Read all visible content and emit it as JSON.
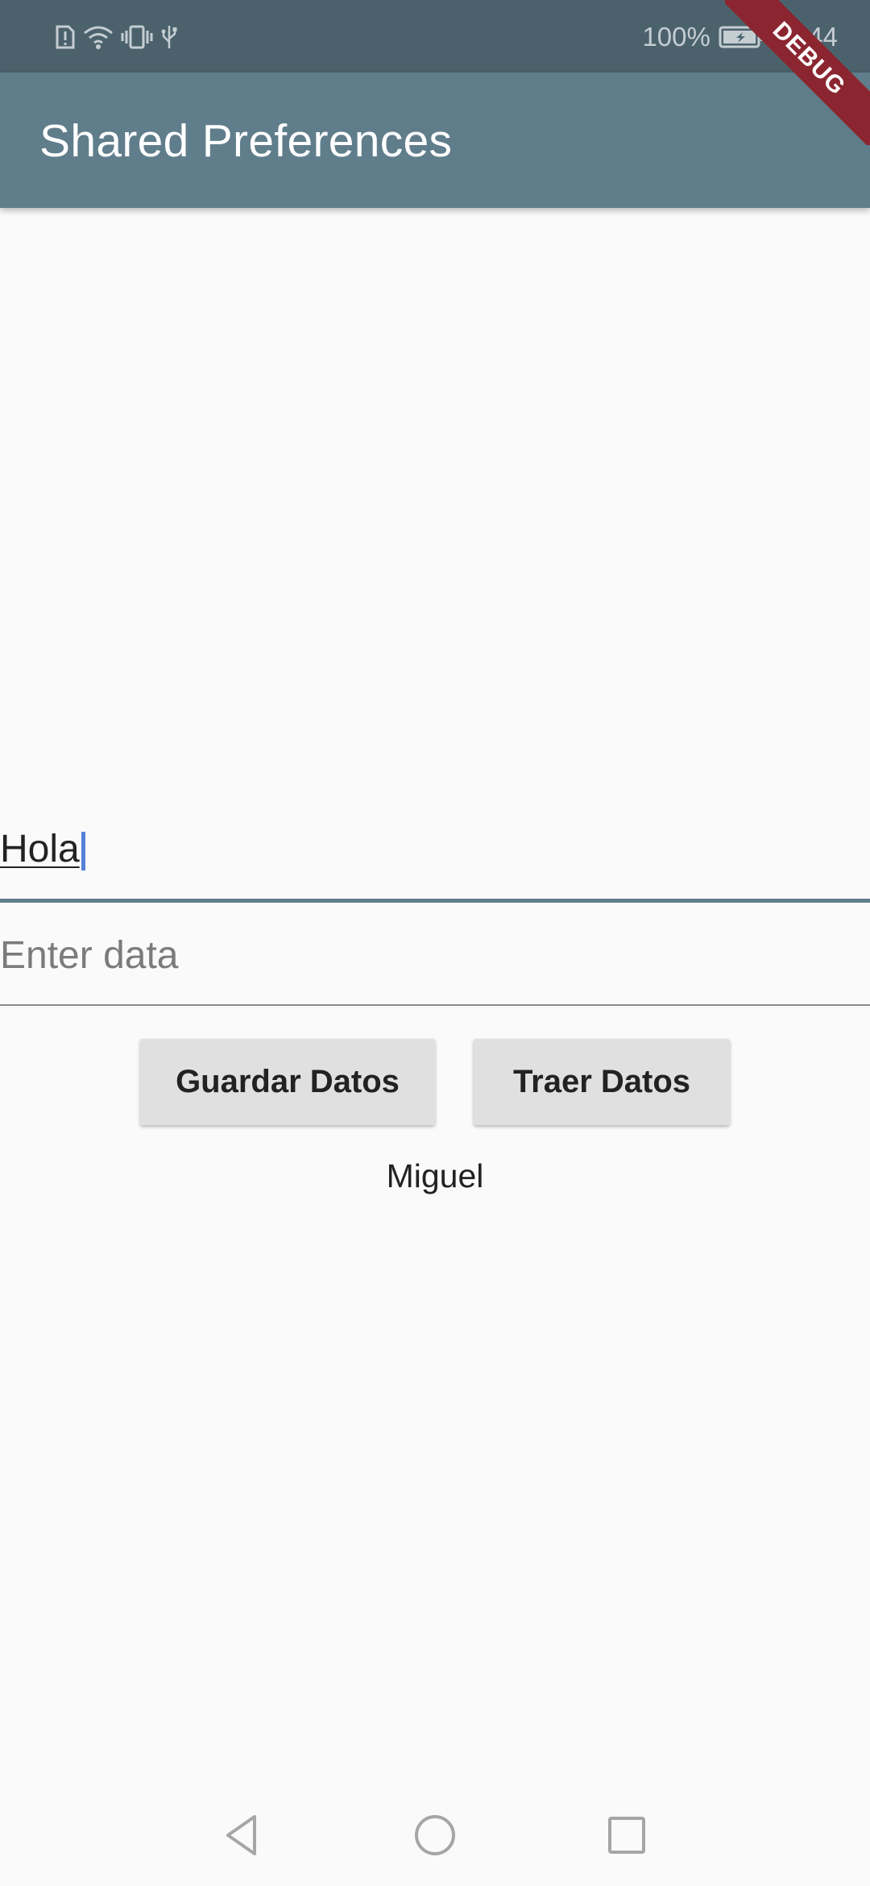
{
  "status_bar": {
    "battery_percent": "100%",
    "time": "11:44",
    "icons": [
      "sim-alert-icon",
      "wifi-icon",
      "vibrate-icon",
      "usb-icon",
      "battery-icon"
    ]
  },
  "app_bar": {
    "title": "Shared Preferences",
    "debug_label": "DEBUG",
    "color": "#607d8b"
  },
  "form": {
    "field_one_value": "Hola",
    "field_two_value": "",
    "field_two_placeholder": "Enter data",
    "save_button_label": "Guardar Datos",
    "fetch_button_label": "Traer Datos",
    "result_text": "Miguel"
  },
  "nav": {
    "icons": [
      "back-icon",
      "home-icon",
      "recent-apps-icon"
    ]
  }
}
